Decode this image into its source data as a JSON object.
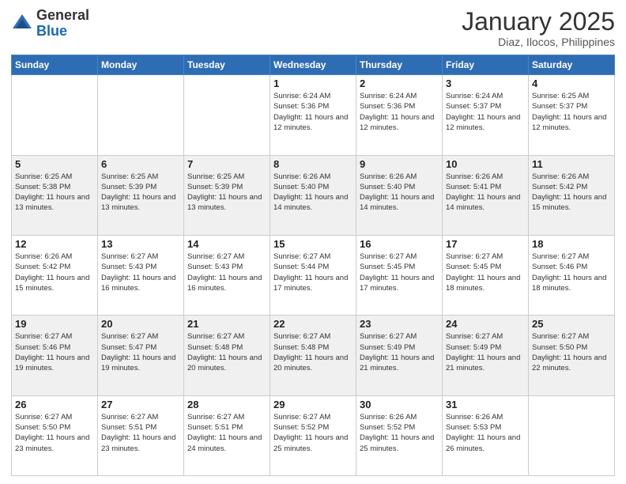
{
  "logo": {
    "general": "General",
    "blue": "Blue"
  },
  "title": "January 2025",
  "location": "Diaz, Ilocos, Philippines",
  "days_of_week": [
    "Sunday",
    "Monday",
    "Tuesday",
    "Wednesday",
    "Thursday",
    "Friday",
    "Saturday"
  ],
  "weeks": [
    [
      {
        "day": "",
        "info": ""
      },
      {
        "day": "",
        "info": ""
      },
      {
        "day": "",
        "info": ""
      },
      {
        "day": "1",
        "info": "Sunrise: 6:24 AM\nSunset: 5:36 PM\nDaylight: 11 hours and 12 minutes."
      },
      {
        "day": "2",
        "info": "Sunrise: 6:24 AM\nSunset: 5:36 PM\nDaylight: 11 hours and 12 minutes."
      },
      {
        "day": "3",
        "info": "Sunrise: 6:24 AM\nSunset: 5:37 PM\nDaylight: 11 hours and 12 minutes."
      },
      {
        "day": "4",
        "info": "Sunrise: 6:25 AM\nSunset: 5:37 PM\nDaylight: 11 hours and 12 minutes."
      }
    ],
    [
      {
        "day": "5",
        "info": "Sunrise: 6:25 AM\nSunset: 5:38 PM\nDaylight: 11 hours and 13 minutes."
      },
      {
        "day": "6",
        "info": "Sunrise: 6:25 AM\nSunset: 5:39 PM\nDaylight: 11 hours and 13 minutes."
      },
      {
        "day": "7",
        "info": "Sunrise: 6:25 AM\nSunset: 5:39 PM\nDaylight: 11 hours and 13 minutes."
      },
      {
        "day": "8",
        "info": "Sunrise: 6:26 AM\nSunset: 5:40 PM\nDaylight: 11 hours and 14 minutes."
      },
      {
        "day": "9",
        "info": "Sunrise: 6:26 AM\nSunset: 5:40 PM\nDaylight: 11 hours and 14 minutes."
      },
      {
        "day": "10",
        "info": "Sunrise: 6:26 AM\nSunset: 5:41 PM\nDaylight: 11 hours and 14 minutes."
      },
      {
        "day": "11",
        "info": "Sunrise: 6:26 AM\nSunset: 5:42 PM\nDaylight: 11 hours and 15 minutes."
      }
    ],
    [
      {
        "day": "12",
        "info": "Sunrise: 6:26 AM\nSunset: 5:42 PM\nDaylight: 11 hours and 15 minutes."
      },
      {
        "day": "13",
        "info": "Sunrise: 6:27 AM\nSunset: 5:43 PM\nDaylight: 11 hours and 16 minutes."
      },
      {
        "day": "14",
        "info": "Sunrise: 6:27 AM\nSunset: 5:43 PM\nDaylight: 11 hours and 16 minutes."
      },
      {
        "day": "15",
        "info": "Sunrise: 6:27 AM\nSunset: 5:44 PM\nDaylight: 11 hours and 17 minutes."
      },
      {
        "day": "16",
        "info": "Sunrise: 6:27 AM\nSunset: 5:45 PM\nDaylight: 11 hours and 17 minutes."
      },
      {
        "day": "17",
        "info": "Sunrise: 6:27 AM\nSunset: 5:45 PM\nDaylight: 11 hours and 18 minutes."
      },
      {
        "day": "18",
        "info": "Sunrise: 6:27 AM\nSunset: 5:46 PM\nDaylight: 11 hours and 18 minutes."
      }
    ],
    [
      {
        "day": "19",
        "info": "Sunrise: 6:27 AM\nSunset: 5:46 PM\nDaylight: 11 hours and 19 minutes."
      },
      {
        "day": "20",
        "info": "Sunrise: 6:27 AM\nSunset: 5:47 PM\nDaylight: 11 hours and 19 minutes."
      },
      {
        "day": "21",
        "info": "Sunrise: 6:27 AM\nSunset: 5:48 PM\nDaylight: 11 hours and 20 minutes."
      },
      {
        "day": "22",
        "info": "Sunrise: 6:27 AM\nSunset: 5:48 PM\nDaylight: 11 hours and 20 minutes."
      },
      {
        "day": "23",
        "info": "Sunrise: 6:27 AM\nSunset: 5:49 PM\nDaylight: 11 hours and 21 minutes."
      },
      {
        "day": "24",
        "info": "Sunrise: 6:27 AM\nSunset: 5:49 PM\nDaylight: 11 hours and 21 minutes."
      },
      {
        "day": "25",
        "info": "Sunrise: 6:27 AM\nSunset: 5:50 PM\nDaylight: 11 hours and 22 minutes."
      }
    ],
    [
      {
        "day": "26",
        "info": "Sunrise: 6:27 AM\nSunset: 5:50 PM\nDaylight: 11 hours and 23 minutes."
      },
      {
        "day": "27",
        "info": "Sunrise: 6:27 AM\nSunset: 5:51 PM\nDaylight: 11 hours and 23 minutes."
      },
      {
        "day": "28",
        "info": "Sunrise: 6:27 AM\nSunset: 5:51 PM\nDaylight: 11 hours and 24 minutes."
      },
      {
        "day": "29",
        "info": "Sunrise: 6:27 AM\nSunset: 5:52 PM\nDaylight: 11 hours and 25 minutes."
      },
      {
        "day": "30",
        "info": "Sunrise: 6:26 AM\nSunset: 5:52 PM\nDaylight: 11 hours and 25 minutes."
      },
      {
        "day": "31",
        "info": "Sunrise: 6:26 AM\nSunset: 5:53 PM\nDaylight: 11 hours and 26 minutes."
      },
      {
        "day": "",
        "info": ""
      }
    ]
  ]
}
